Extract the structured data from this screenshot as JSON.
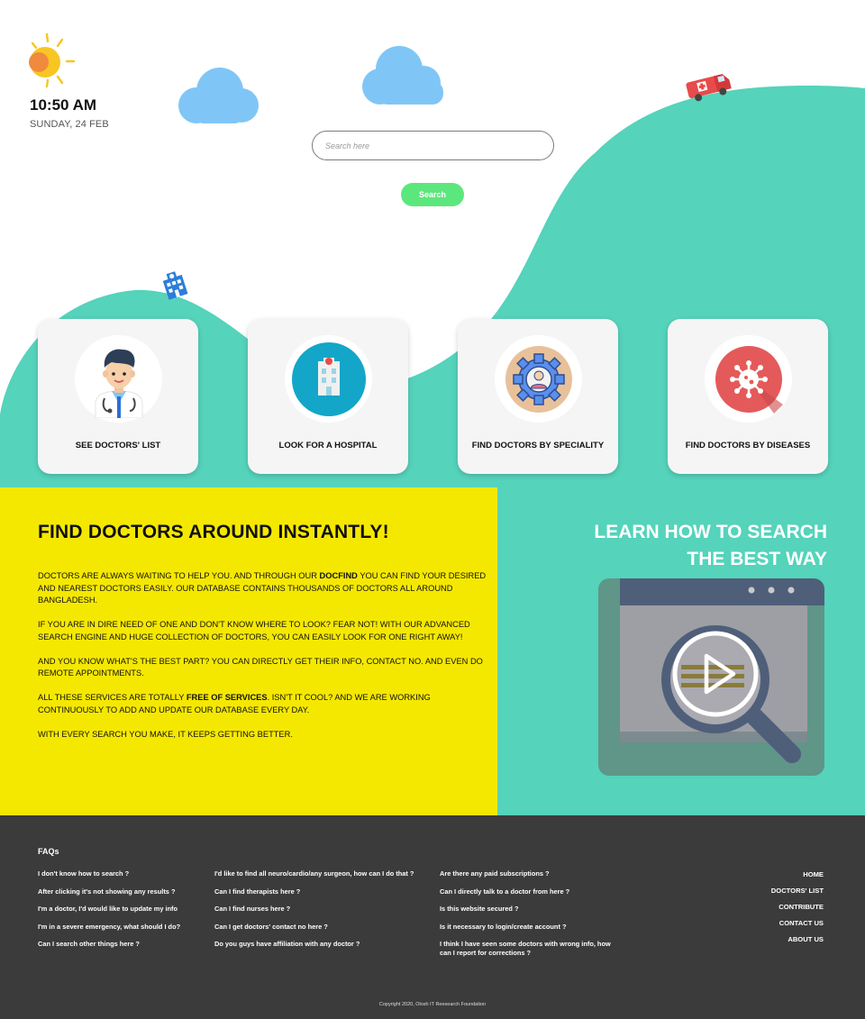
{
  "clock": {
    "time": "10:50 AM",
    "date": "SUNDAY, 24 FEB"
  },
  "search": {
    "placeholder": "Search here",
    "button_label": "Search"
  },
  "cards": [
    {
      "label": "SEE DOCTORS' LIST",
      "icon": "doctor-icon"
    },
    {
      "label": "LOOK FOR A HOSPITAL",
      "icon": "hospital-icon"
    },
    {
      "label": "FIND DOCTORS BY SPECIALITY",
      "icon": "speciality-gear-icon"
    },
    {
      "label": "FIND DOCTORS BY DISEASES",
      "icon": "virus-icon"
    }
  ],
  "info": {
    "title": "FIND DOCTORS AROUND INSTANTLY!",
    "p1_a": "DOCTORS ARE ALWAYS WAITING TO HELP YOU. AND THROUGH OUR ",
    "p1_b": "DOCFIND",
    "p1_c": " YOU CAN FIND YOUR DESIRED AND NEAREST DOCTORS EASILY. OUR DATABASE CONTAINS THOUSANDS OF DOCTORS ALL AROUND BANGLADESH.",
    "p2": "IF YOU ARE IN DIRE NEED OF ONE AND DON'T KNOW WHERE TO LOOK? FEAR NOT! WITH OUR ADVANCED SEARCH ENGINE AND HUGE COLLECTION OF DOCTORS, YOU CAN EASILY LOOK FOR ONE RIGHT AWAY!",
    "p3": "AND YOU KNOW WHAT'S THE BEST PART? YOU CAN DIRECTLY GET THEIR INFO, CONTACT NO. AND EVEN DO REMOTE APPOINTMENTS.",
    "p4_a": "ALL THESE SERVICES ARE TOTALLY ",
    "p4_b": "FREE OF SERVICES",
    "p4_c": ". ISN'T IT COOL? AND WE ARE WORKING CONTINUOUSLY TO ADD AND UPDATE OUR DATABASE EVERY DAY.",
    "p5": "WITH EVERY SEARCH YOU MAKE, IT KEEPS GETTING BETTER."
  },
  "learn": {
    "line1": "LEARN HOW TO SEARCH",
    "line2": "THE BEST WAY"
  },
  "footer": {
    "faq_heading": "FAQs",
    "faq_col1": [
      "I don't know how to search ?",
      "After clicking it's not showing any results ?",
      "I'm a doctor, I'd would like to update my info",
      "I'm in a severe emergency, what should I do?",
      "Can I search other things here ?"
    ],
    "faq_col2": [
      "I'd like to find all neuro/cardio/any surgeon, how can I do that ?",
      "Can I find therapists here ?",
      "Can I find nurses here ?",
      "Can I get doctors' contact no here ?",
      "Do you guys have affiliation with any doctor ?"
    ],
    "faq_col3": [
      "Are there any paid subscriptions ?",
      "Can I directly talk to a doctor from here ?",
      "Is this website secured ?",
      "Is it necessary to login/create account ?",
      "I think I have seen some doctors with wrong info, how can I report for corrections ?"
    ],
    "nav": [
      "HOME",
      "DOCTORS' LIST",
      "CONTRIBUTE",
      "CONTACT US",
      "ABOUT US"
    ],
    "copyright": "Copyright 2020, Olosh IT Reesearch Foundation"
  },
  "colors": {
    "teal": "#55d3bb",
    "yellow": "#f5e800",
    "search_green": "#5ce77d",
    "footer_dark": "#3b3b3b",
    "cloud_blue": "#7fc6f6"
  }
}
